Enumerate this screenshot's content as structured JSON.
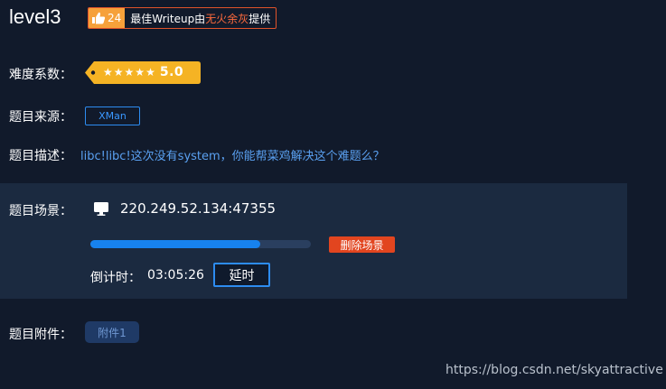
{
  "header": {
    "title": "level3",
    "writeup_badge": {
      "like_count": "24",
      "text_prefix": "最佳Writeup由",
      "author": "无火余灰",
      "text_suffix": "提供"
    }
  },
  "difficulty": {
    "label": "难度系数：",
    "stars": [
      "★",
      "★",
      "★",
      "★",
      "★"
    ],
    "score": "5.0"
  },
  "source": {
    "label": "题目来源：",
    "tag": "XMan"
  },
  "description": {
    "label": "题目描述：",
    "text": "libc!libc!这次没有system，你能帮菜鸡解决这个难题么？"
  },
  "scene": {
    "label": "题目场景：",
    "icon": "monitor-icon",
    "address": "220.249.52.134:47355",
    "progress_fraction": 0.77,
    "delete_button": "删除场景",
    "countdown_label": "倒计时：",
    "countdown_value": "03:05:26",
    "extend_button": "延时"
  },
  "attachments": {
    "label": "题目附件：",
    "items": [
      "附件1"
    ]
  },
  "watermark": "https://blog.csdn.net/skyattractive",
  "colors": {
    "background": "#111a2b",
    "panel": "#1b2a40",
    "accent_blue": "#2d8cf0",
    "danger_red": "#e2451f",
    "difficulty_gold": "#f5b324",
    "like_orange": "#f6a13a"
  }
}
